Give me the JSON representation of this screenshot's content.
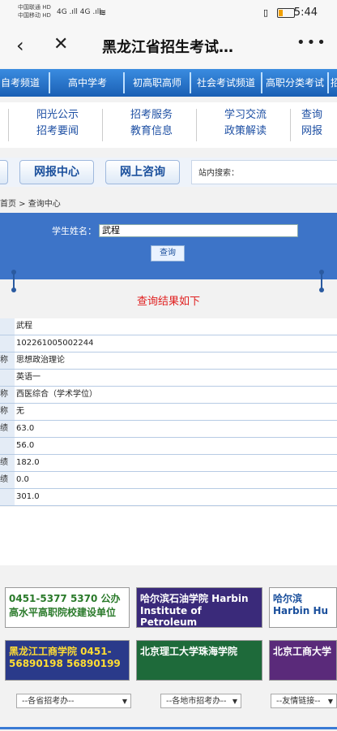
{
  "status": {
    "carrier1": "中国联通 HD",
    "carrier2": "中国移动 HD",
    "signals": "4G .ıll 4G .ıll",
    "battery_icon": "battery-icon",
    "vibrate_icon": "vibrate-icon",
    "time": "5:44"
  },
  "nav": {
    "back": "‹",
    "close": "✕",
    "title": "黑龙江省招生考试…",
    "more": "•••"
  },
  "channels": [
    "自考频道",
    "高中学考",
    "初高职高师",
    "社会考试频道",
    "高职分类考试",
    "招"
  ],
  "categories": [
    [
      "阳光公示",
      "招考要闻"
    ],
    [
      "招考服务",
      "教育信息"
    ],
    [
      "学习交流",
      "政策解读"
    ],
    [
      "查询",
      "网报"
    ]
  ],
  "buttons": {
    "wangbao": "网报中心",
    "zixun": "网上咨询"
  },
  "search": {
    "label": "站内搜索："
  },
  "breadcrumb": "首页 > 查询中心",
  "query": {
    "name_label": "学生姓名：",
    "name_value": "武程",
    "query_button": "查询"
  },
  "result_title": "查询结果如下",
  "results": [
    {
      "left": "",
      "value": "武程"
    },
    {
      "left": "",
      "value": "102261005002244"
    },
    {
      "left": "称",
      "value": "思想政治理论"
    },
    {
      "left": "",
      "value": "英语一"
    },
    {
      "left": "称",
      "value": "西医综合（学术学位）"
    },
    {
      "left": "称",
      "value": "无"
    },
    {
      "left": "绩",
      "value": "63.0"
    },
    {
      "left": "",
      "value": "56.0"
    },
    {
      "left": "绩",
      "value": "182.0"
    },
    {
      "left": "绩",
      "value": "0.0"
    },
    {
      "left": "",
      "value": "301.0"
    }
  ],
  "banners": [
    {
      "text": "0451-5377 5370 公办高水平高职院校建设单位",
      "color": "#2a7a2a"
    },
    {
      "text": "哈尔滨石油学院 Harbin Institute of Petroleum",
      "color": "#ffffff"
    },
    {
      "text": "哈尔滨 Harbin Hu",
      "color": "#1a4f9c"
    },
    {
      "text": "黑龙江工商学院 0451-56890198 56890199",
      "color": "#ffdd33"
    },
    {
      "text": "北京理工大学珠海学院",
      "color": "#ffffff"
    },
    {
      "text": "北京工商大学",
      "color": "#ffffff"
    }
  ],
  "selects": [
    "--各省招考办--",
    "--各地市招考办--",
    "--友情链接--"
  ]
}
